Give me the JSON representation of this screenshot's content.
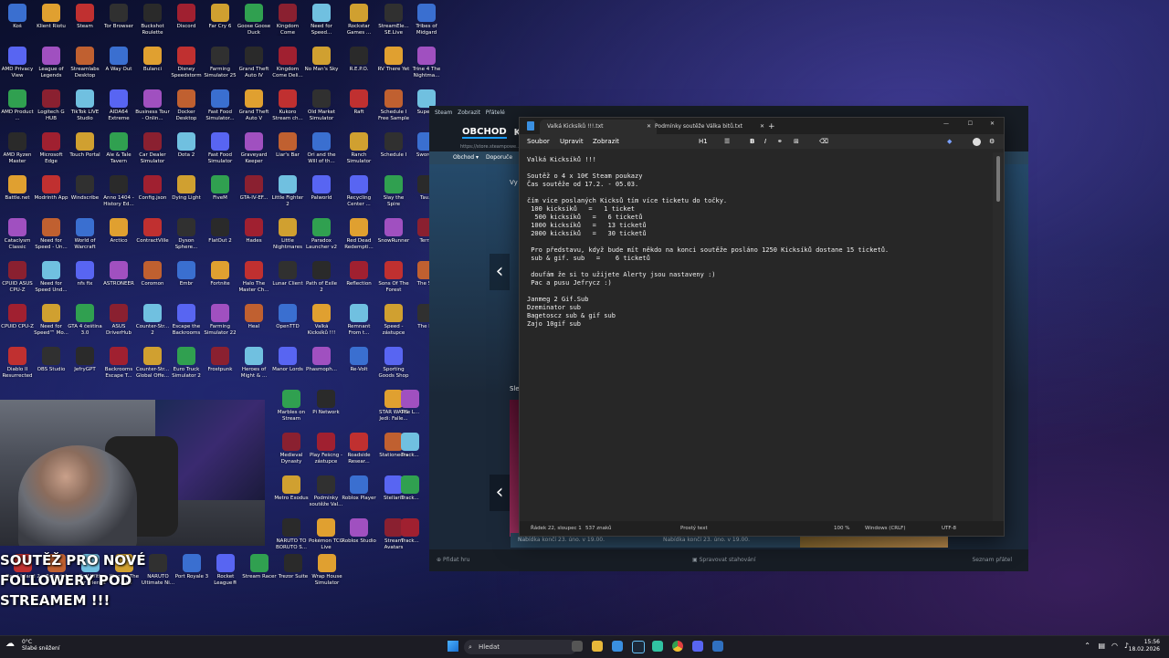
{
  "desktop": {
    "icons": [
      {
        "label": "Koš",
        "x": 0
      },
      {
        "label": "Klient Riotu"
      },
      {
        "label": "Steam"
      },
      {
        "label": "Tor Browser"
      },
      {
        "label": "Buckshot Roulette"
      },
      {
        "label": "Discord"
      },
      {
        "label": "Far Cry 6"
      },
      {
        "label": "Goose Goose Duck"
      },
      {
        "label": "Kingdom Come Delive..."
      },
      {
        "label": "Need for Speed..."
      },
      {
        "label": "AMD Privacy View"
      },
      {
        "label": "League of Legends"
      },
      {
        "label": "Streamlabs Desktop"
      },
      {
        "label": "A Way Out"
      },
      {
        "label": "Bulanci"
      },
      {
        "label": "Disney Speedstorm"
      },
      {
        "label": "Farming Simulator 25"
      },
      {
        "label": "Grand Theft Auto IV"
      },
      {
        "label": "Kingdom Come Deli..."
      },
      {
        "label": "No Man's Sky"
      },
      {
        "label": "AMD Product ..."
      },
      {
        "label": "Logitech G HUB"
      },
      {
        "label": "TikTok LIVE Studio"
      },
      {
        "label": "AIDA64 Extreme"
      },
      {
        "label": "Business Tour - Onlin..."
      },
      {
        "label": "Docker Desktop"
      },
      {
        "label": "Fast Food Simulator..."
      },
      {
        "label": "Grand Theft Auto V"
      },
      {
        "label": "Kukoro Stream ch..."
      },
      {
        "label": "Old Market Simulator"
      },
      {
        "label": "AMD Ryzen Master"
      },
      {
        "label": "Microsoft Edge"
      },
      {
        "label": "Touch Portal"
      },
      {
        "label": "Ale & Tale Tavern"
      },
      {
        "label": "Car Dealer Simulator"
      },
      {
        "label": "Dota 2"
      },
      {
        "label": "Fast Food Simulator"
      },
      {
        "label": "Graveyard Keeper"
      },
      {
        "label": "Liar's Bar"
      },
      {
        "label": "Ori and the Will of th..."
      },
      {
        "label": "Battle.net"
      },
      {
        "label": "Modrinth App"
      },
      {
        "label": "Windscribe"
      },
      {
        "label": "Anno 1404 - History Ed..."
      },
      {
        "label": "Config.json"
      },
      {
        "label": "Dying Light"
      },
      {
        "label": "FiveM"
      },
      {
        "label": "GTA-IV-EF..."
      },
      {
        "label": "Little Fighter 2"
      },
      {
        "label": "Palworld"
      },
      {
        "label": "Cataclysm Classic"
      },
      {
        "label": "Need for Speed - Un..."
      },
      {
        "label": "World of Warcraft"
      },
      {
        "label": "Arctico"
      },
      {
        "label": "ContractVille"
      },
      {
        "label": "Dyson Sphere..."
      },
      {
        "label": "FlatOut 2"
      },
      {
        "label": "Hades"
      },
      {
        "label": "Little Nightmares"
      },
      {
        "label": "Paradox Launcher v2"
      },
      {
        "label": "CPUID ASUS CPU-Z"
      },
      {
        "label": "Need for Speed Und..."
      },
      {
        "label": "nfs fix"
      },
      {
        "label": "ASTRONEER"
      },
      {
        "label": "Coromon"
      },
      {
        "label": "Embr"
      },
      {
        "label": "Fortnite"
      },
      {
        "label": "Halo The Master Ch..."
      },
      {
        "label": "Lunar Client"
      },
      {
        "label": "Path of Exile 2"
      },
      {
        "label": "CPUID CPU-Z"
      },
      {
        "label": "Need for Speed™ Mo..."
      },
      {
        "label": "GTA 4 čeština 3.0"
      },
      {
        "label": "ASUS DriverHub"
      },
      {
        "label": "Counter-Str... 2"
      },
      {
        "label": "Escape the Backrooms"
      },
      {
        "label": "Farming Simulator 22"
      },
      {
        "label": "Heal"
      },
      {
        "label": "OpenTTD"
      },
      {
        "label": "Valká Kicksíků !!!"
      },
      {
        "label": "Diablo II Resurrected"
      },
      {
        "label": "OBS Studio"
      },
      {
        "label": "JefryGPT"
      },
      {
        "label": "Backrooms Escape T..."
      },
      {
        "label": "Counter-Str... Global Offe..."
      },
      {
        "label": "Euro Truck Simulator 2"
      },
      {
        "label": "Frostpunk"
      },
      {
        "label": "Heroes of Might & ..."
      },
      {
        "label": "Manor Lords"
      },
      {
        "label": "Phasmoph..."
      }
    ],
    "icons_col_b": [
      {
        "label": "Rockstar Games ..."
      },
      {
        "label": "StreamEle... SE.Live"
      },
      {
        "label": "Tribes of Midgard"
      },
      {
        "label": "Wreckfest"
      },
      {
        "label": "jefry ehm 2_"
      },
      {
        "label": "R.E.P.O."
      },
      {
        "label": "RV There Yet"
      },
      {
        "label": "Trine 4 The Nightma..."
      },
      {
        "label": "Zoeti"
      },
      {
        "label": "jefryluil"
      },
      {
        "label": "Raft"
      },
      {
        "label": "Schedule I Free Sample"
      },
      {
        "label": "Super..."
      },
      {
        "label": "Ranch Simulator"
      },
      {
        "label": "Schedule I"
      },
      {
        "label": "Sword..."
      },
      {
        "label": "Recycling Center ..."
      },
      {
        "label": "Slay the Spire"
      },
      {
        "label": "Tav..."
      },
      {
        "label": "Red Dead Redempti..."
      },
      {
        "label": "SnowRunner"
      },
      {
        "label": "Terr..."
      },
      {
        "label": "Reflection"
      },
      {
        "label": "Sons Of The Forest"
      },
      {
        "label": "The S..."
      },
      {
        "label": "Remnant From t..."
      },
      {
        "label": "Speed - zástupce"
      },
      {
        "label": "The F..."
      },
      {
        "label": "Re-Volt"
      },
      {
        "label": "Sporting Goods Shop"
      },
      {
        "label": "Marbles on Stream"
      },
      {
        "label": "Pi Network"
      },
      {
        "label": "STAR WARS Jedi: Falle..."
      },
      {
        "label": "The L..."
      },
      {
        "label": "Medieval Dynasty"
      },
      {
        "label": "Play Fešcng - zástupce"
      },
      {
        "label": "Roadside Resear..."
      },
      {
        "label": "Stationeers"
      },
      {
        "label": "Track..."
      },
      {
        "label": "Metro Exodus"
      },
      {
        "label": "Podmínky soutěže Val..."
      },
      {
        "label": "Roblox Player"
      },
      {
        "label": "Stellaris"
      },
      {
        "label": "Track..."
      },
      {
        "label": "NARUTO TO BORUTO S..."
      },
      {
        "label": "Pokémon TCG Live"
      },
      {
        "label": "Roblox Studio"
      },
      {
        "label": "Stream Avatars"
      },
      {
        "label": "Track..."
      },
      {
        "label": "Dead Island 2"
      },
      {
        "label": "Fallout 4"
      },
      {
        "label": "Golf With Your Friends"
      },
      {
        "label": "King Of The Castle"
      },
      {
        "label": "NARUTO Ultimate Ni..."
      },
      {
        "label": "Port Royale 3"
      },
      {
        "label": "Rocket League®"
      },
      {
        "label": "Stream Racer"
      },
      {
        "label": "Trezor Suite"
      },
      {
        "label": "Wrap House Simulator"
      },
      {
        "label": "SSD disk prosinec 25"
      },
      {
        "label": "Donate war 26"
      }
    ]
  },
  "overlay": {
    "line1": "SOUTĚŽ PRO NOVÉ",
    "line2": "FOLLOWERY POD",
    "line3": "STREAMEM !!!"
  },
  "steam": {
    "title": "Steam",
    "menu_items": [
      "Steam",
      "Zobrazit",
      "Přátelé"
    ],
    "nav_store": "OBCHOD",
    "nav_kn": "KN",
    "url": "https://store.steampowe...",
    "submenu": [
      "Obchod",
      "Doporuče"
    ],
    "card1": "Nabídka končí 23. úno. v 19.00.",
    "card2": "Nabídka končí 23. úno. v 19.00.",
    "vy": "Vy",
    "sle": "Sle",
    "add_game": "Přidat hru",
    "downloads": "Spravovat stahování",
    "friends": "Seznam přátel"
  },
  "notepad": {
    "tab_active": "Valká Kicksíků !!!.txt",
    "tab_other": "Podmínky soutěže Válka bitů.txt",
    "menu": [
      "Soubor",
      "Upravit",
      "Zobrazit"
    ],
    "heading": "H1",
    "lines": [
      "Valká Kicksíků !!!",
      "",
      "Soutěž o 4 x 10€ Steam poukazy",
      "Čas soutěže od 17.2. - 05.03.",
      "",
      "čím více poslaných Kicksů tím více ticketu do točky.",
      " 100 kicksíků   =   1 ticket",
      "  500 kicksíků   =   6 ticketů",
      " 1000 kicksíků   =   13 ticketů",
      " 2000 kicksíků   =   30 ticketů",
      "",
      " Pro představu, když bude mít někdo na konci soutěže posláno 1250 Kicksíků dostane 15 ticketů.",
      " sub & gif. sub   =    6 ticketů",
      "",
      " doufám že si to užijete Alerty jsou nastaveny :)",
      " Pac a pusu Jefrycz :)",
      "",
      "Janmeg 2 Gif.Sub",
      "Dzeminator sub",
      "Bagetoscz sub & gif sub",
      "Zajo 10gif sub"
    ],
    "status": {
      "position": "Řádek 22, sloupec 1",
      "chars": "537 znaků",
      "format": "Prostý text",
      "zoom": "100 %",
      "eol": "Windows (CRLF)",
      "encoding": "UTF-8"
    }
  },
  "taskbar": {
    "weather_temp": "0°C",
    "weather_desc": "Slabé sněžení",
    "search": "Hledat",
    "time": "15:56",
    "date": "18.02.2026"
  }
}
